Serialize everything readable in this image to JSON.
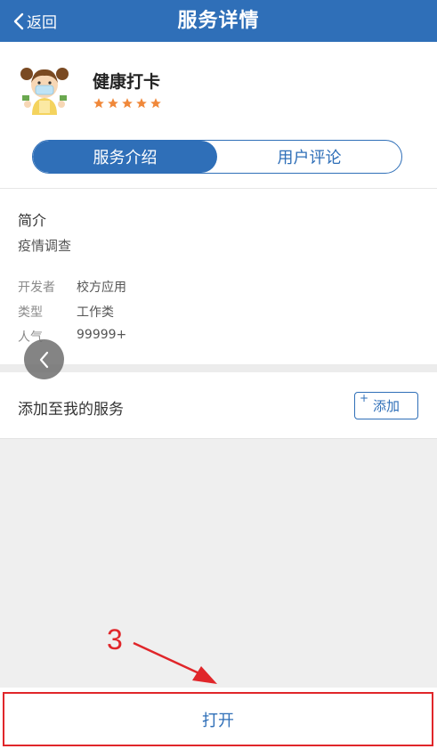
{
  "header": {
    "back_label": "返回",
    "title": "服务详情"
  },
  "app": {
    "name": "健康打卡",
    "rating": 5,
    "rating_max": 5,
    "star_color": "#f0883a"
  },
  "tabs": [
    {
      "label": "服务介绍",
      "active": true
    },
    {
      "label": "用户评论",
      "active": false
    }
  ],
  "info": {
    "heading": "简介",
    "description": "疫情调查",
    "details": [
      {
        "key": "开发者",
        "value": "校方应用"
      },
      {
        "key": "类型",
        "value": "工作类"
      },
      {
        "key": "人气",
        "value": "99999+"
      }
    ]
  },
  "add_service": {
    "label": "添加至我的服务",
    "button_label": "添加",
    "button_icon": "plus-icon"
  },
  "annotation": {
    "step_number": "3",
    "color": "#e0262a"
  },
  "open_button": {
    "label": "打开"
  },
  "colors": {
    "primary": "#2f6fb8",
    "background": "#efefef"
  }
}
